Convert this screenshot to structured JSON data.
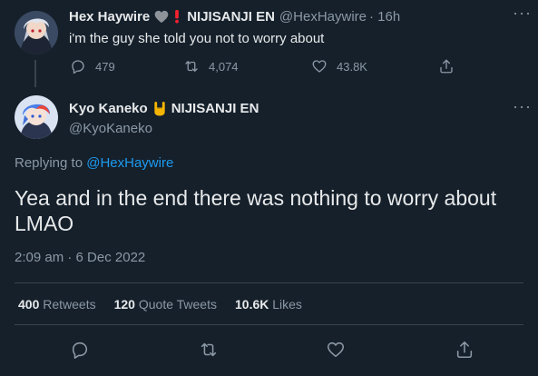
{
  "reply_to_tweet": {
    "author_name": "Hex Haywire",
    "affiliation": "NIJISANJI EN",
    "handle": "@HexHaywire",
    "time": "· 16h",
    "text": "i'm the guy she told you not to worry about",
    "actions": {
      "replies": "479",
      "retweets": "4,074",
      "likes": "43.8K"
    },
    "more_icon": "more-horizontal-icon"
  },
  "main_tweet": {
    "author_name": "Kyo Kaneko",
    "affiliation": "NIJISANJI EN",
    "handle": "@KyoKaneko",
    "replying_label": "Replying to",
    "replying_handle": "@HexHaywire",
    "text": "Yea and in the end there was nothing to worry about LMAO",
    "timestamp": "2:09 am · 6 Dec 2022",
    "stats": {
      "retweets_value": "400",
      "retweets_label": "Retweets",
      "quotes_value": "120",
      "quotes_label": "Quote Tweets",
      "likes_value": "10.6K",
      "likes_label": "Likes"
    }
  },
  "colors": {
    "background": "#15202b",
    "text": "#e7e9ea",
    "muted": "#8b98a5",
    "link": "#1d9bf0",
    "border": "#38444d",
    "badge_red": "#f4212e"
  }
}
